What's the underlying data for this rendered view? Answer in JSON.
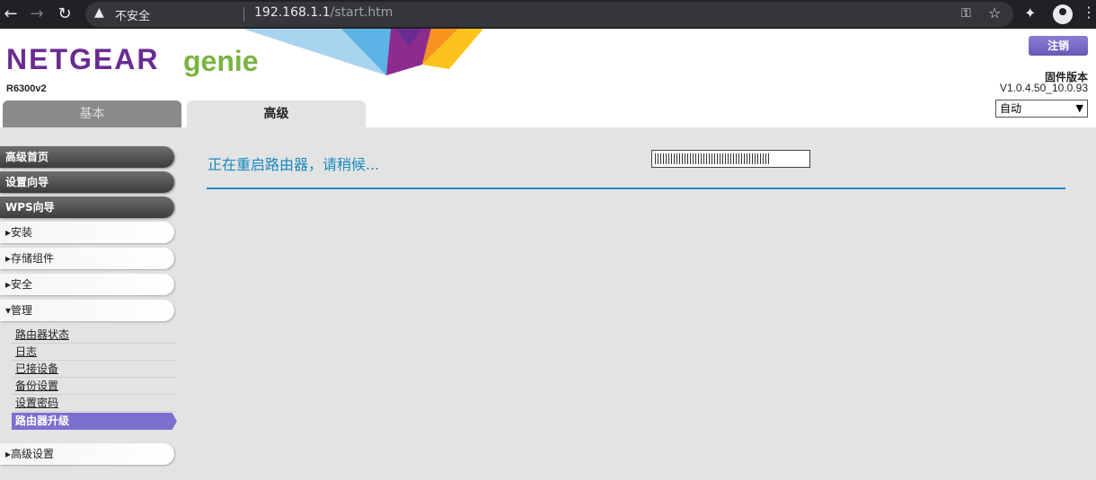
{
  "browser": {
    "insecure_label": "不安全",
    "url_host": "192.168.1.1",
    "url_path": "/start.htm"
  },
  "header": {
    "logo_main": "NETGEAR",
    "logo_sub": "genie",
    "model": "R6300v2",
    "logout_label": "注销",
    "firmware_label": "固件版本",
    "firmware_version": "V1.0.4.50_10.0.93",
    "language_selected": "自动"
  },
  "tabs": {
    "basic": "基本",
    "advanced": "高级"
  },
  "sidebar": {
    "home": "高级首页",
    "setup_wizard": "设置向导",
    "wps_wizard": "WPS向导",
    "setup": "▸安装",
    "storage": "▸存储组件",
    "security": "▸安全",
    "admin": "▾管理",
    "admin_items": [
      "路由器状态",
      "日志",
      "已接设备",
      "备份设置",
      "设置密码"
    ],
    "admin_active": "路由器升级",
    "advanced_setup": "▸高级设置"
  },
  "main": {
    "restart_message": "正在重启路由器，请稍候...",
    "progress_fraction": 0.75
  },
  "colors": {
    "accent_blue": "#1a8ac0",
    "purple": "#6a2c91",
    "green": "#7cb342",
    "active_item": "#7b6fd0"
  }
}
